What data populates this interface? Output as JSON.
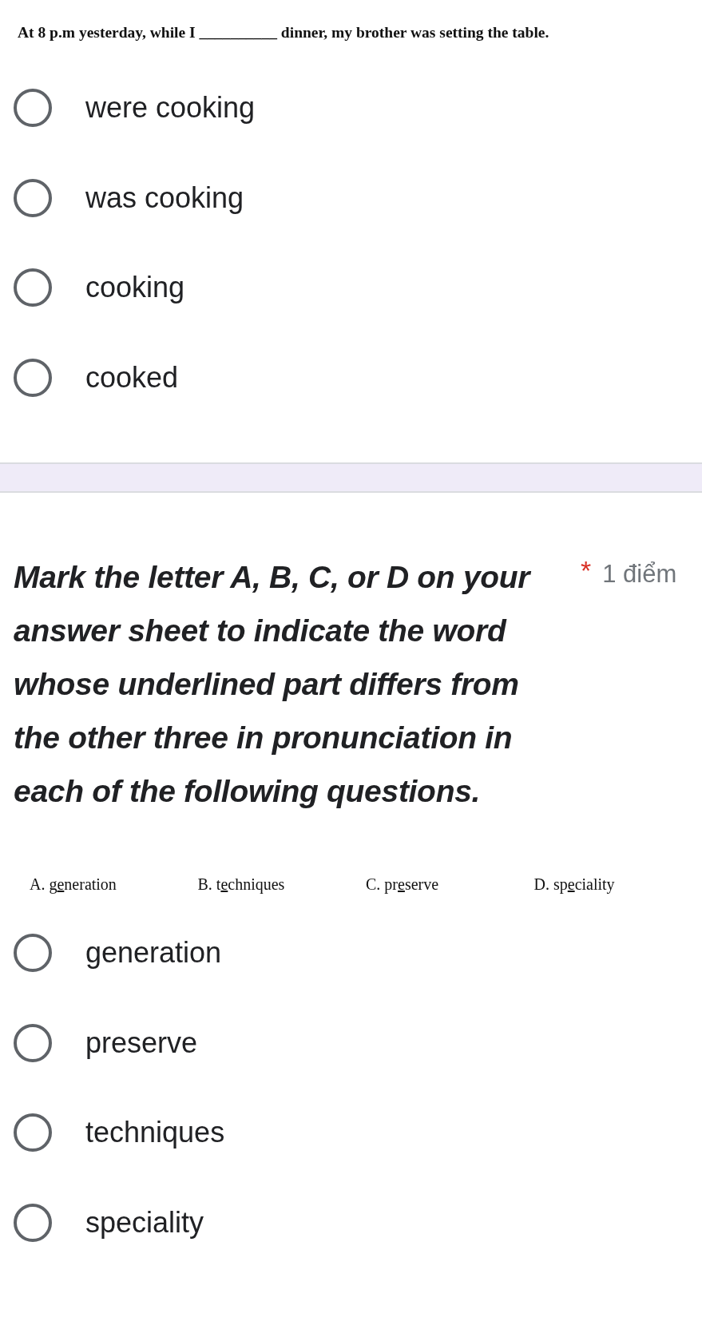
{
  "question_1": {
    "prompt": "At 8 p.m yesterday, while I __________ dinner, my brother was setting the table.",
    "options": [
      {
        "label": "were cooking",
        "selected": false
      },
      {
        "label": "was cooking",
        "selected": false
      },
      {
        "label": "cooking",
        "selected": false
      },
      {
        "label": "cooked",
        "selected": false
      }
    ]
  },
  "question_2": {
    "title": "Mark the letter A, B, C, or D on your answer sheet to indicate the word whose underlined part differs from the other three in pronunciation in each of the following questions.",
    "required_mark": "*",
    "points": "1 điểm",
    "choices": [
      {
        "letter": "A.",
        "before": "g",
        "underlined": "e",
        "after": "neration"
      },
      {
        "letter": "B.",
        "before": "t",
        "underlined": "e",
        "after": "chniques"
      },
      {
        "letter": "C.",
        "before": "pr",
        "underlined": "e",
        "after": "serve"
      },
      {
        "letter": "D.",
        "before": "sp",
        "underlined": "e",
        "after": "ciality"
      }
    ],
    "options": [
      {
        "label": "generation",
        "selected": false
      },
      {
        "label": "preserve",
        "selected": false
      },
      {
        "label": "techniques",
        "selected": false
      },
      {
        "label": "speciality",
        "selected": false
      }
    ]
  }
}
